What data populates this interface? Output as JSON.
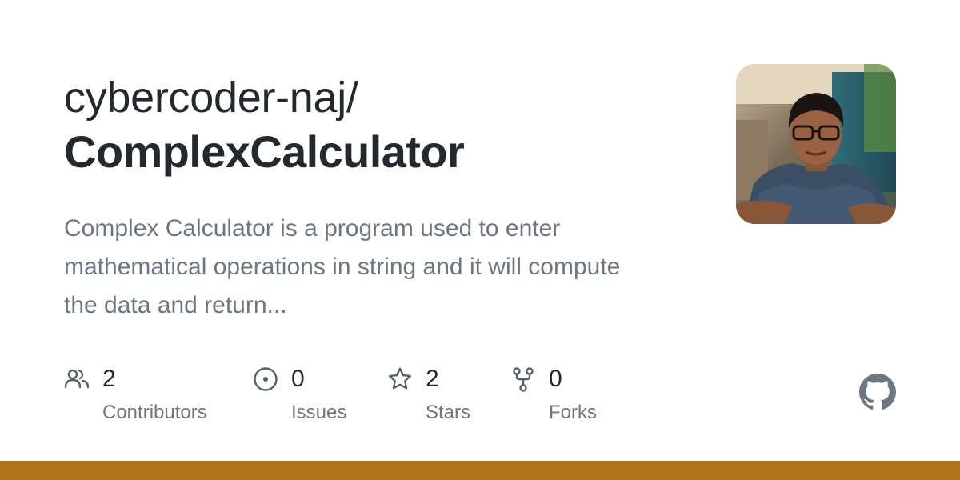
{
  "repo": {
    "owner": "cybercoder-naj/",
    "name": "ComplexCalculator",
    "description": "Complex Calculator is a program used to enter mathematical operations in string and it will compute the data and return..."
  },
  "stats": [
    {
      "count": "2",
      "label": "Contributors",
      "icon": "people-icon"
    },
    {
      "count": "0",
      "label": "Issues",
      "icon": "issue-icon"
    },
    {
      "count": "2",
      "label": "Stars",
      "icon": "star-icon"
    },
    {
      "count": "0",
      "label": "Forks",
      "icon": "fork-icon"
    }
  ],
  "colors": {
    "language_bar": "#b07219",
    "heading": "#24292f",
    "muted": "#6e7781",
    "icon": "#57606a"
  }
}
